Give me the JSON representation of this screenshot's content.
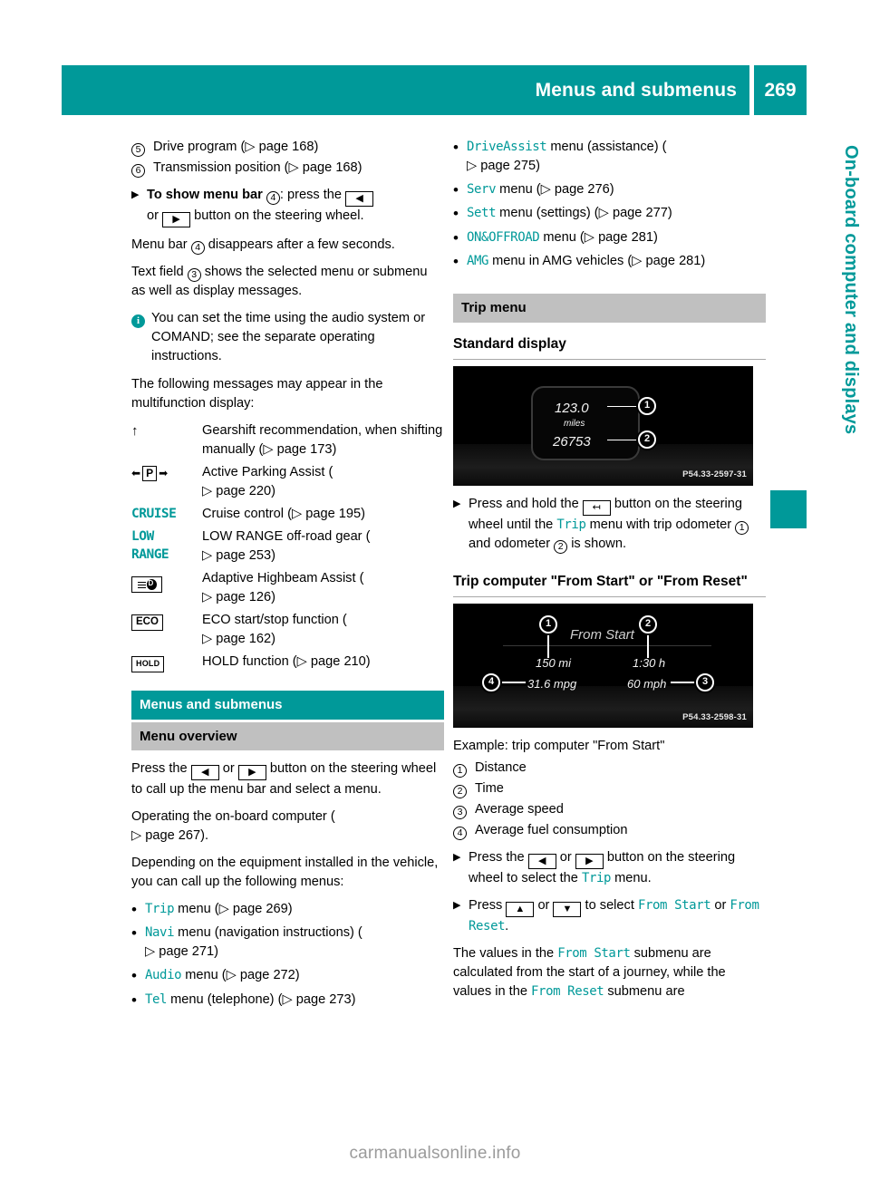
{
  "header": {
    "title": "Menus and submenus",
    "page_number": "269"
  },
  "side_tab": {
    "label": "On-board computer and displays"
  },
  "footer": {
    "brand": "carmanualsonline.info"
  },
  "left_column": {
    "legend_items": [
      {
        "marker": "5",
        "text": "Drive program (",
        "ref": "page 168",
        "tail": ")"
      },
      {
        "marker": "6",
        "text": "Transmission position (",
        "ref": "page 168",
        "tail": ")"
      }
    ],
    "step_show_menu_bar": {
      "bold": "To show menu bar",
      "marker": "4",
      "after_marker": ": press the",
      "key_left": "◀",
      "or": "or",
      "key_right": "▶",
      "tail": "button on the steering wheel."
    },
    "para_menu_bar": {
      "pre": "Menu bar",
      "marker": "4",
      "post": "disappears after a few seconds."
    },
    "para_text_field": {
      "pre": "Text field",
      "marker": "3",
      "post": "shows the selected menu or submenu as well as display messages."
    },
    "info_note": "You can set the time using the audio system or COMAND; see the separate operating instructions.",
    "para_messages": "The following messages may appear in the multifunction display:",
    "symbol_table": [
      {
        "symbol_type": "arrow-up",
        "symbol_text": "↑",
        "description": "Gearshift recommendation, when shifting manually (",
        "ref": "page 173",
        "tail": ")"
      },
      {
        "symbol_type": "parking-p",
        "symbol_text": "P",
        "description": "Active Parking Assist (",
        "ref": "page 220",
        "tail": ")"
      },
      {
        "symbol_type": "teal-text",
        "symbol_text": "CRUISE",
        "description": "Cruise control (",
        "ref": "page 195",
        "tail": ")"
      },
      {
        "symbol_type": "teal-text-two-line",
        "symbol_text": "LOW",
        "symbol_text2": "RANGE",
        "description": "LOW RANGE off-road gear (",
        "ref": "page 253",
        "tail": ")"
      },
      {
        "symbol_type": "highbeam",
        "symbol_text": "",
        "description": "Adaptive Highbeam Assist (",
        "ref": "page 126",
        "tail": ")"
      },
      {
        "symbol_type": "box",
        "symbol_text": "ECO",
        "description": "ECO start/stop function (",
        "ref": "page 162",
        "tail": ")"
      },
      {
        "symbol_type": "box-small",
        "symbol_text": "HOLD",
        "description": "HOLD function (",
        "ref": "page 210",
        "tail": ")"
      }
    ],
    "section_heading_teal": "Menus and submenus",
    "section_heading_grey": "Menu overview",
    "press_button_text": {
      "pre": "Press the",
      "key_left": "◀",
      "or": "or",
      "key_right": "▶",
      "tail": "button on the steering wheel to call up the menu bar and select a menu."
    },
    "para_operating": {
      "text": "Operating the on-board computer (",
      "ref": "page 267",
      "tail": ")."
    },
    "para_depending": "Depending on the equipment installed in the vehicle, you can call up the following menus:",
    "menu_list": [
      {
        "name": "Trip",
        "mid": " menu (",
        "ref": "page 269",
        "tail": ")"
      },
      {
        "name": "Navi",
        "mid": " menu (navigation instructions) (",
        "ref": "page 271",
        "tail": ")"
      },
      {
        "name": "Audio",
        "mid": " menu (",
        "ref": "page 272",
        "tail": ")"
      },
      {
        "name": "Tel",
        "mid": " menu (telephone) (",
        "ref": "page 273",
        "tail": ")"
      }
    ]
  },
  "right_column": {
    "menu_list_continued": [
      {
        "name": "DriveAssist",
        "mid": " menu (assistance) (",
        "ref": "page 275",
        "tail": ")"
      },
      {
        "name": "Serv",
        "mid": " menu (",
        "ref": "page 276",
        "tail": ")"
      },
      {
        "name": "Sett",
        "mid": " menu (settings) (",
        "ref": "page 277",
        "tail": ")"
      },
      {
        "name": "ON&OFFROAD",
        "mid": " menu (",
        "ref": "page 281",
        "tail": ")"
      },
      {
        "name": "AMG",
        "mid": " menu in AMG vehicles (",
        "ref": "page 281",
        "tail": ")"
      }
    ],
    "section_heading_grey": "Trip menu",
    "subheading_standard": "Standard display",
    "display_one": {
      "trip_odometer": "123.0",
      "unit": "miles",
      "odometer": "26753",
      "callout_1": "1",
      "callout_2": "2",
      "image_code": "P54.33-2597-31"
    },
    "step_press_hold": {
      "pre": "Press and hold the",
      "key": "↤",
      "mid": "button on the steering wheel until the",
      "menu": "Trip",
      "mid2": "menu with trip odometer",
      "marker_1": "1",
      "mid3": "and odometer",
      "marker_2": "2",
      "tail": "is shown."
    },
    "subheading_trip_computer": "Trip computer \"From Start\" or \"From Reset\"",
    "display_two": {
      "title": "From Start",
      "distance": "150 mi",
      "time": "1:30 h",
      "consumption": "31.6 mpg",
      "speed": "60 mph",
      "callout_1": "1",
      "callout_2": "2",
      "callout_3": "3",
      "callout_4": "4",
      "image_code": "P54.33-2598-31"
    },
    "caption": "Example: trip computer \"From Start\"",
    "legend_items": [
      {
        "marker": "1",
        "text": "Distance"
      },
      {
        "marker": "2",
        "text": "Time"
      },
      {
        "marker": "3",
        "text": "Average speed"
      },
      {
        "marker": "4",
        "text": "Average fuel consumption"
      }
    ],
    "step_press_select": {
      "pre": "Press the",
      "key_left": "◀",
      "or": "or",
      "key_right": "▶",
      "mid": "button on the steering wheel to select the",
      "menu": "Trip",
      "tail": "menu."
    },
    "step_press_updown": {
      "pre": "Press",
      "key_up": "▲",
      "or": "or",
      "key_down": "▼",
      "mid": "to select",
      "menu1": "From Start",
      "or2": "or",
      "menu2": "From Reset",
      "tail": "."
    },
    "para_values": {
      "pre": "The values in the",
      "menu1": "From Start",
      "mid": "submenu are calculated from the start of a journey, while the values in the",
      "menu2": "From Reset",
      "tail": "submenu are"
    }
  },
  "colors": {
    "teal": "#009999",
    "grey_heading": "#c0c0c0",
    "footer_grey": "#9b9b9b"
  }
}
